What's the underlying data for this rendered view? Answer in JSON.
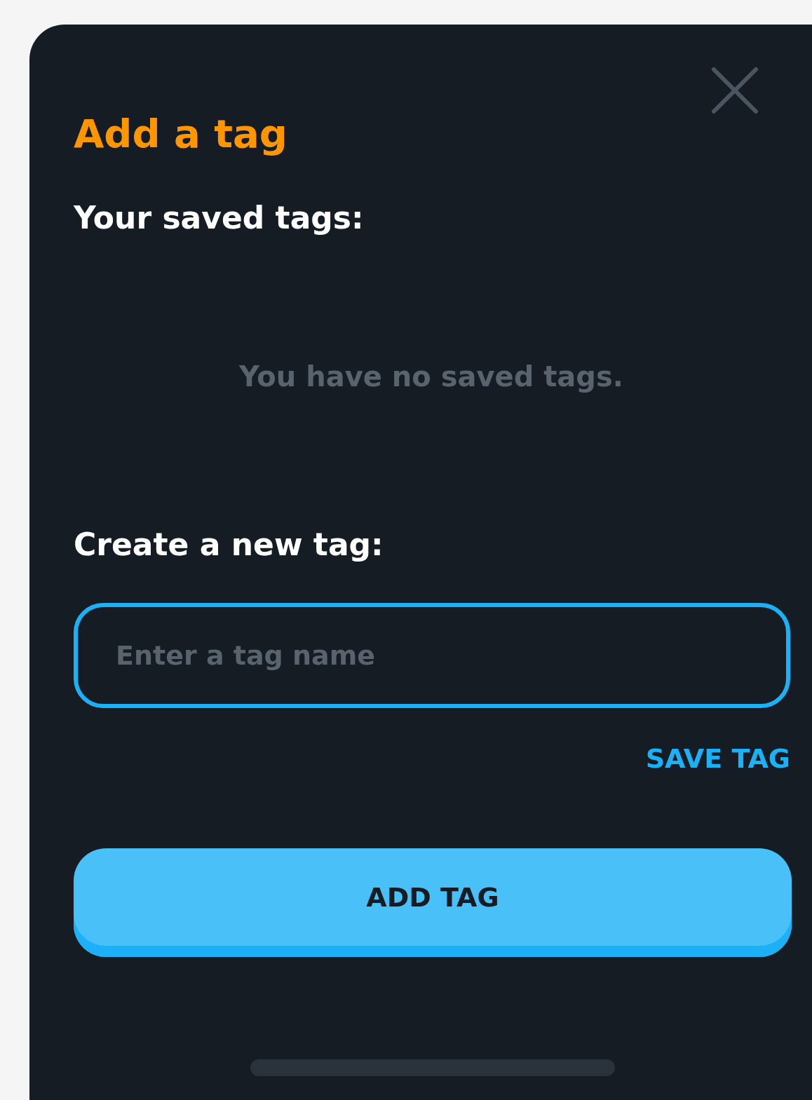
{
  "dialog": {
    "title": "Add a tag",
    "saved_heading": "Your saved tags:",
    "empty_message": "You have no saved tags.",
    "create_heading": "Create a new tag:",
    "tag_field": {
      "placeholder": "Enter a tag name"
    },
    "save_link": "SAVE TAG",
    "add_button": "ADD TAG"
  }
}
